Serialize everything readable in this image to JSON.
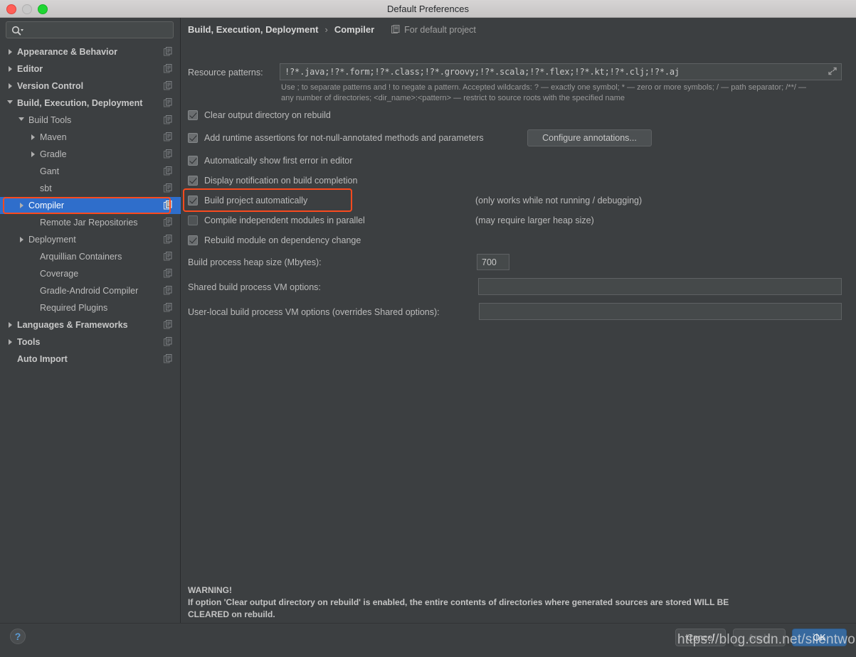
{
  "window": {
    "title": "Default Preferences",
    "controls": [
      "close",
      "minimize",
      "zoom"
    ]
  },
  "sidebar": {
    "search": {
      "placeholder": "",
      "value": "",
      "icon": "search-icon"
    },
    "items": [
      {
        "label": "Appearance & Behavior",
        "indent": 0,
        "arrow": "right",
        "bold": true,
        "selected": false,
        "copy": true
      },
      {
        "label": "Editor",
        "indent": 0,
        "arrow": "right",
        "bold": true,
        "selected": false,
        "copy": true
      },
      {
        "label": "Version Control",
        "indent": 0,
        "arrow": "right",
        "bold": true,
        "selected": false,
        "copy": true
      },
      {
        "label": "Build, Execution, Deployment",
        "indent": 0,
        "arrow": "down",
        "bold": true,
        "selected": false,
        "copy": true
      },
      {
        "label": "Build Tools",
        "indent": 1,
        "arrow": "down",
        "bold": false,
        "selected": false,
        "copy": true
      },
      {
        "label": "Maven",
        "indent": 2,
        "arrow": "right",
        "bold": false,
        "selected": false,
        "copy": true
      },
      {
        "label": "Gradle",
        "indent": 2,
        "arrow": "right",
        "bold": false,
        "selected": false,
        "copy": true
      },
      {
        "label": "Gant",
        "indent": 2,
        "arrow": "none",
        "bold": false,
        "selected": false,
        "copy": true
      },
      {
        "label": "sbt",
        "indent": 2,
        "arrow": "none",
        "bold": false,
        "selected": false,
        "copy": true
      },
      {
        "label": "Compiler",
        "indent": 1,
        "arrow": "right",
        "bold": false,
        "selected": true,
        "copy": true
      },
      {
        "label": "Remote Jar Repositories",
        "indent": 2,
        "arrow": "none",
        "bold": false,
        "selected": false,
        "copy": true
      },
      {
        "label": "Deployment",
        "indent": 1,
        "arrow": "right",
        "bold": false,
        "selected": false,
        "copy": true
      },
      {
        "label": "Arquillian Containers",
        "indent": 2,
        "arrow": "none",
        "bold": false,
        "selected": false,
        "copy": true
      },
      {
        "label": "Coverage",
        "indent": 2,
        "arrow": "none",
        "bold": false,
        "selected": false,
        "copy": true
      },
      {
        "label": "Gradle-Android Compiler",
        "indent": 2,
        "arrow": "none",
        "bold": false,
        "selected": false,
        "copy": true
      },
      {
        "label": "Required Plugins",
        "indent": 2,
        "arrow": "none",
        "bold": false,
        "selected": false,
        "copy": true
      },
      {
        "label": "Languages & Frameworks",
        "indent": 0,
        "arrow": "right",
        "bold": true,
        "selected": false,
        "copy": true
      },
      {
        "label": "Tools",
        "indent": 0,
        "arrow": "right",
        "bold": true,
        "selected": false,
        "copy": true
      },
      {
        "label": "Auto Import",
        "indent": 0,
        "arrow": "none",
        "bold": true,
        "selected": false,
        "copy": true
      }
    ]
  },
  "breadcrumb": {
    "root": "Build, Execution, Deployment",
    "separator": "›",
    "leaf": "Compiler",
    "scope": "For default project",
    "scope_icon": "project-icon"
  },
  "main": {
    "resource_patterns": {
      "label": "Resource patterns:",
      "value": "!?*.java;!?*.form;!?*.class;!?*.groovy;!?*.scala;!?*.flex;!?*.kt;!?*.clj;!?*.aj",
      "expand_icon": "expand-icon"
    },
    "hint_line1": "Use ; to separate patterns and ! to negate a pattern. Accepted wildcards: ? — exactly one symbol; * — zero or more symbols; / — path separator; /**/ —",
    "hint_line2": "any number of directories; <dir_name>:<pattern> — restrict to source roots with the specified name",
    "checkboxes": [
      {
        "label": "Clear output directory on rebuild",
        "checked": true,
        "note": "",
        "highlighted": false
      },
      {
        "label": "Add runtime assertions for not-null-annotated methods and parameters",
        "checked": true,
        "note": "",
        "highlighted": false
      },
      {
        "label": "Automatically show first error in editor",
        "checked": true,
        "note": "",
        "highlighted": false
      },
      {
        "label": "Display notification on build completion",
        "checked": true,
        "note": "",
        "highlighted": false
      },
      {
        "label": "Build project automatically",
        "checked": true,
        "note": "(only works while not running / debugging)",
        "highlighted": true
      },
      {
        "label": "Compile independent modules in parallel",
        "checked": false,
        "note": "(may require larger heap size)",
        "highlighted": false
      },
      {
        "label": "Rebuild module on dependency change",
        "checked": true,
        "note": "",
        "highlighted": false
      }
    ],
    "configure_annotations_button": "Configure annotations...",
    "fields": [
      {
        "label": "Build process heap size (Mbytes):",
        "value": "700",
        "placeholder": ""
      },
      {
        "label": "Shared build process VM options:",
        "value": "",
        "placeholder": ""
      },
      {
        "label": "User-local build process VM options (overrides Shared options):",
        "value": "",
        "placeholder": ""
      }
    ],
    "warning": {
      "title": "WARNING!",
      "line1": "If option 'Clear output directory on rebuild' is enabled, the entire contents of directories where generated sources are stored WILL BE",
      "line2": "CLEARED on rebuild."
    }
  },
  "footer": {
    "help_label": "?",
    "buttons": [
      {
        "label": "Cancel",
        "style": "normal"
      },
      {
        "label": "Apply",
        "style": "disabled"
      },
      {
        "label": "OK",
        "style": "primary"
      }
    ]
  },
  "watermark": "https://blog.csdn.net/silentwolfyh",
  "colors": {
    "window_bg": "#3c3f41",
    "selection_blue": "#2f6ecb",
    "highlight_red": "#fb4a1e",
    "primary_button": "#37699e",
    "text": "#bbbbbb"
  }
}
